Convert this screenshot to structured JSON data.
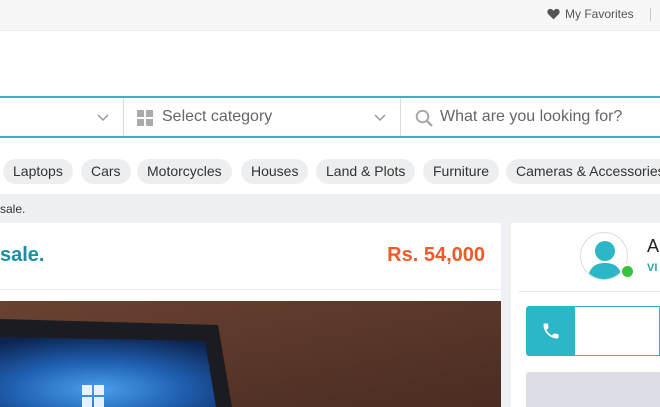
{
  "topbar": {
    "favorites_label": "My Favorites"
  },
  "search": {
    "category_placeholder": "Select category",
    "query_placeholder": "What are you looking for?"
  },
  "categories": [
    "Laptops",
    "Cars",
    "Motorcycles",
    "Houses",
    "Land & Plots",
    "Furniture",
    "Cameras & Accessories"
  ],
  "breadcrumb": {
    "text": "sale."
  },
  "listing": {
    "title": "sale.",
    "price": "Rs. 54,000"
  },
  "seller": {
    "name": "Al",
    "subtitle": "VI"
  },
  "colors": {
    "accent": "#3ab4c4",
    "price": "#f05a28",
    "title": "#1a8fa3",
    "online": "#37c33a"
  },
  "icons": [
    "heart-icon",
    "grid-icon",
    "chevron-down-icon",
    "search-icon",
    "user-avatar-icon",
    "phone-icon"
  ]
}
